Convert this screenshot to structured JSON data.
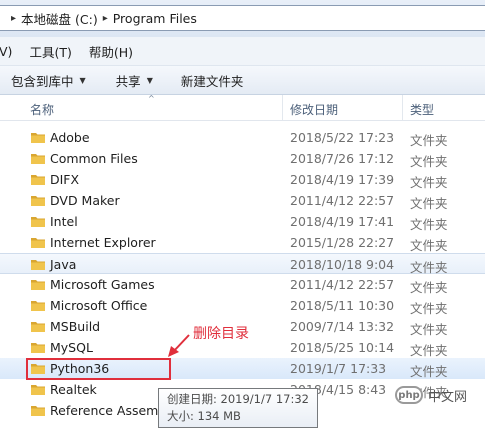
{
  "address": {
    "crumbs": [
      "本地磁盘 (C:)",
      "Program Files"
    ],
    "separator": "▸"
  },
  "menu": {
    "items": [
      "V)",
      "工具(T)",
      "帮助(H)"
    ]
  },
  "toolbar": {
    "include_library": "包含到库中",
    "share": "共享",
    "new_folder": "新建文件夹",
    "caret": "▼"
  },
  "columns": {
    "name": "名称",
    "modified": "修改日期",
    "type": "类型",
    "sort_caret": "^"
  },
  "rows": [
    {
      "name": "Adobe",
      "date": "2018/5/22 17:23",
      "type": "文件夹"
    },
    {
      "name": "Common Files",
      "date": "2018/7/26 17:12",
      "type": "文件夹"
    },
    {
      "name": "DIFX",
      "date": "2018/4/19 17:39",
      "type": "文件夹"
    },
    {
      "name": "DVD Maker",
      "date": "2011/4/12 22:57",
      "type": "文件夹"
    },
    {
      "name": "Intel",
      "date": "2018/4/19 17:41",
      "type": "文件夹"
    },
    {
      "name": "Internet Explorer",
      "date": "2015/1/28 22:27",
      "type": "文件夹"
    },
    {
      "name": "Java",
      "date": "2018/10/18 9:04",
      "type": "文件夹"
    },
    {
      "name": "Microsoft Games",
      "date": "2011/4/12 22:57",
      "type": "文件夹"
    },
    {
      "name": "Microsoft Office",
      "date": "2018/5/11 10:30",
      "type": "文件夹"
    },
    {
      "name": "MSBuild",
      "date": "2009/7/14 13:32",
      "type": "文件夹"
    },
    {
      "name": "MySQL",
      "date": "2018/5/25 10:14",
      "type": "文件夹"
    },
    {
      "name": "Python36",
      "date": "2019/1/7 17:33",
      "type": "文件夹"
    },
    {
      "name": "Realtek",
      "date": "2018/4/15 8:43",
      "type": "文件夹"
    },
    {
      "name": "Reference Assemb",
      "date": "",
      "type": ""
    }
  ],
  "annotation": {
    "label": "删除目录",
    "color": "#e02f3c"
  },
  "tooltip": {
    "created": "创建日期: 2019/1/7 17:32",
    "size": "大小: 134 MB"
  },
  "watermark": {
    "logo": "php",
    "text": "中文网"
  },
  "colors": {
    "folder": "#f0c44c",
    "folder_dark": "#d9a631",
    "accent_red": "#e02f3c"
  }
}
